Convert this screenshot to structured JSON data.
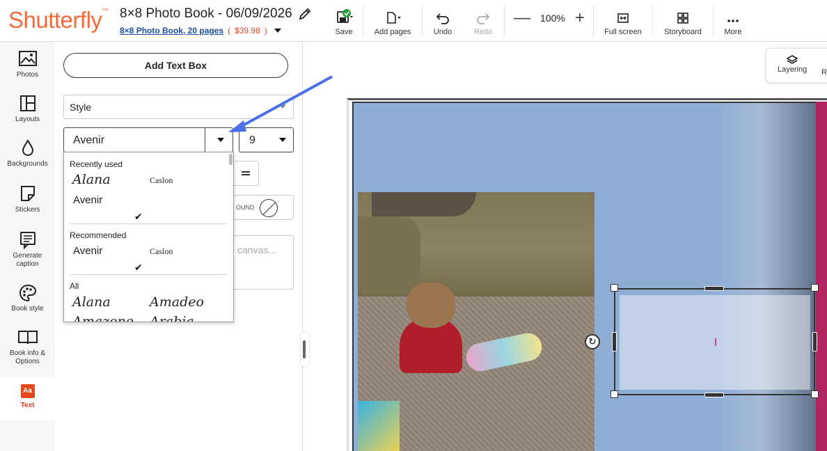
{
  "header": {
    "logo": "Shutterfly",
    "logo_mark": "™",
    "book_title": "8×8 Photo Book - 06/09/2026",
    "book_subtitle": "8×8 Photo Book, 20 pages",
    "price": "$39.98",
    "price_open": "(",
    "price_close": ")"
  },
  "toolbar": {
    "save": "Save",
    "add_pages": "Add pages",
    "undo": "Undo",
    "redo": "Redo",
    "zoom_minus": "—",
    "zoom_level": "100%",
    "zoom_plus": "+",
    "full_screen": "Full screen",
    "storyboard": "Storyboard",
    "more": "More"
  },
  "rail": {
    "photos": "Photos",
    "layouts": "Layouts",
    "backgrounds": "Backgrounds",
    "stickers": "Stickers",
    "generate_caption_1": "Generate",
    "generate_caption_2": "caption",
    "book_style": "Book style",
    "book_info_1": "Book info &",
    "book_info_2": "Options",
    "text_icon": "Aa",
    "text": "Text"
  },
  "panel": {
    "add_text_box": "Add Text Box",
    "style": "Style",
    "font": "Avenir",
    "size": "9",
    "background_label": "OUND",
    "text_placeholder": "canvas..."
  },
  "font_dropdown": {
    "recently_used": "Recently used",
    "recent_1": "Alana",
    "recent_2": "Caslon",
    "recent_3": "Avenir",
    "recommended": "Recommended",
    "rec_1": "Avenir",
    "rec_2": "Caslon",
    "all": "All",
    "all_1": "Alana",
    "all_2": "Amadeo",
    "all_3": "Amazone",
    "all_4": "Arabia",
    "check": "✔"
  },
  "canvas": {
    "layering": "Layering",
    "next_tool": "Re"
  },
  "colors": {
    "brand": "#f26b3a",
    "active": "#d4411f",
    "arrow": "#4a6fe8",
    "page_bg": "#8faed6",
    "spine": "#b0245f"
  }
}
